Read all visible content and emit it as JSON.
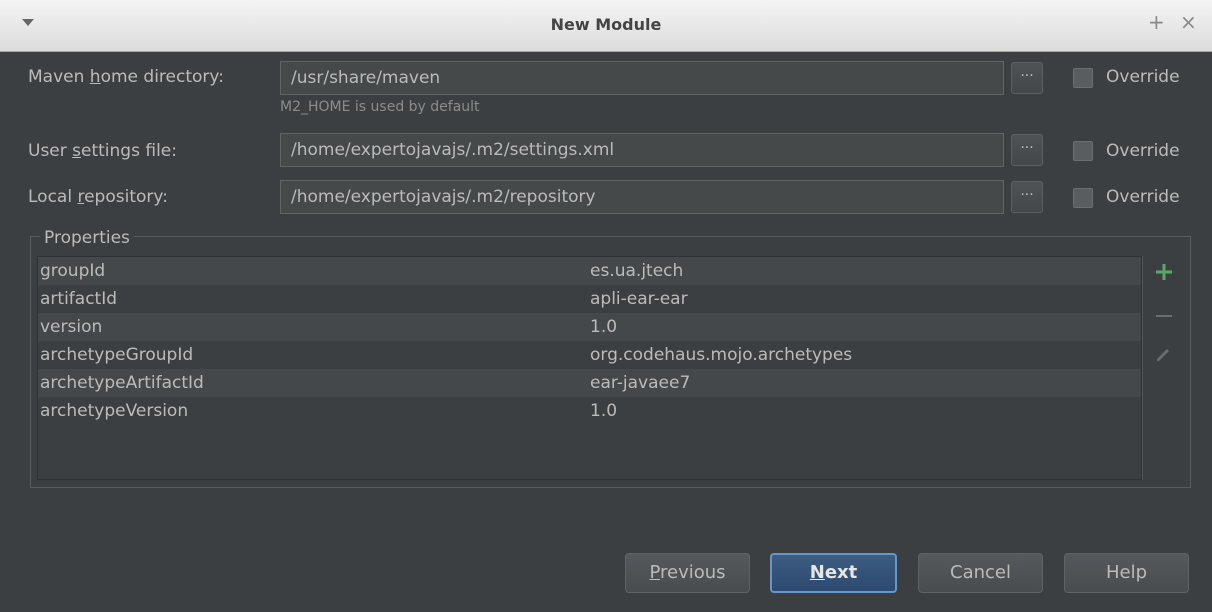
{
  "window": {
    "title": "New Module",
    "plus": "+",
    "close": "×"
  },
  "maven_home": {
    "label_pre": "Maven ",
    "label_mnemonic": "h",
    "label_post": "ome directory:",
    "value": "/usr/share/maven",
    "hint": "M2_HOME is used by default",
    "override_label": "Override"
  },
  "user_settings": {
    "label_pre": "User ",
    "label_mnemonic": "s",
    "label_post": "ettings file:",
    "value": "/home/expertojavajs/.m2/settings.xml",
    "override_label": "Override"
  },
  "local_repo": {
    "label_pre": "Local ",
    "label_mnemonic": "r",
    "label_post": "epository:",
    "value": "/home/expertojavajs/.m2/repository",
    "override_label": "Override"
  },
  "browse_label": "···",
  "properties": {
    "title": "Properties",
    "rows": [
      {
        "key": "groupId",
        "value": "es.ua.jtech"
      },
      {
        "key": "artifactId",
        "value": "apli-ear-ear"
      },
      {
        "key": "version",
        "value": "1.0"
      },
      {
        "key": "archetypeGroupId",
        "value": "org.codehaus.mojo.archetypes"
      },
      {
        "key": "archetypeArtifactId",
        "value": "ear-javaee7"
      },
      {
        "key": "archetypeVersion",
        "value": "1.0"
      }
    ]
  },
  "buttons": {
    "previous_mnemonic": "P",
    "previous_rest": "revious",
    "next_mnemonic": "N",
    "next_rest": "ext",
    "cancel": "Cancel",
    "help": "Help"
  },
  "colors": {
    "add_icon": "#59a869",
    "accent_blue": "#6a95c8"
  }
}
